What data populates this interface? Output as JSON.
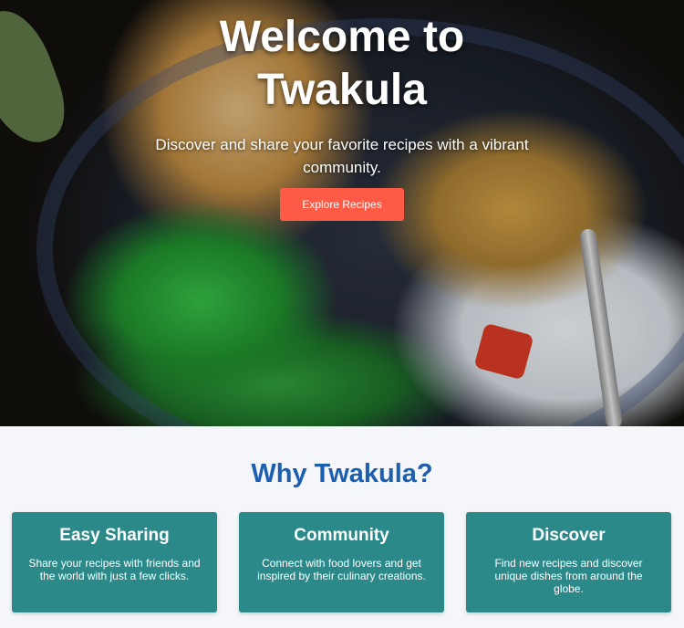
{
  "hero": {
    "title": "Welcome to Twakula",
    "subtitle": "Discover and share your favorite recipes with a vibrant community.",
    "button_label": "Explore Recipes"
  },
  "why": {
    "title": "Why Twakula?",
    "cards": [
      {
        "title": "Easy Sharing",
        "text": "Share your recipes with friends and the world with just a few clicks."
      },
      {
        "title": "Community",
        "text": "Connect with food lovers and get inspired by their culinary creations."
      },
      {
        "title": "Discover",
        "text": "Find new recipes and discover unique dishes from around the globe."
      }
    ]
  },
  "colors": {
    "accent_button": "#ff5a45",
    "card_background": "#2b8a89",
    "section_title": "#1c5fb0",
    "section_background": "#f4f6f9"
  }
}
